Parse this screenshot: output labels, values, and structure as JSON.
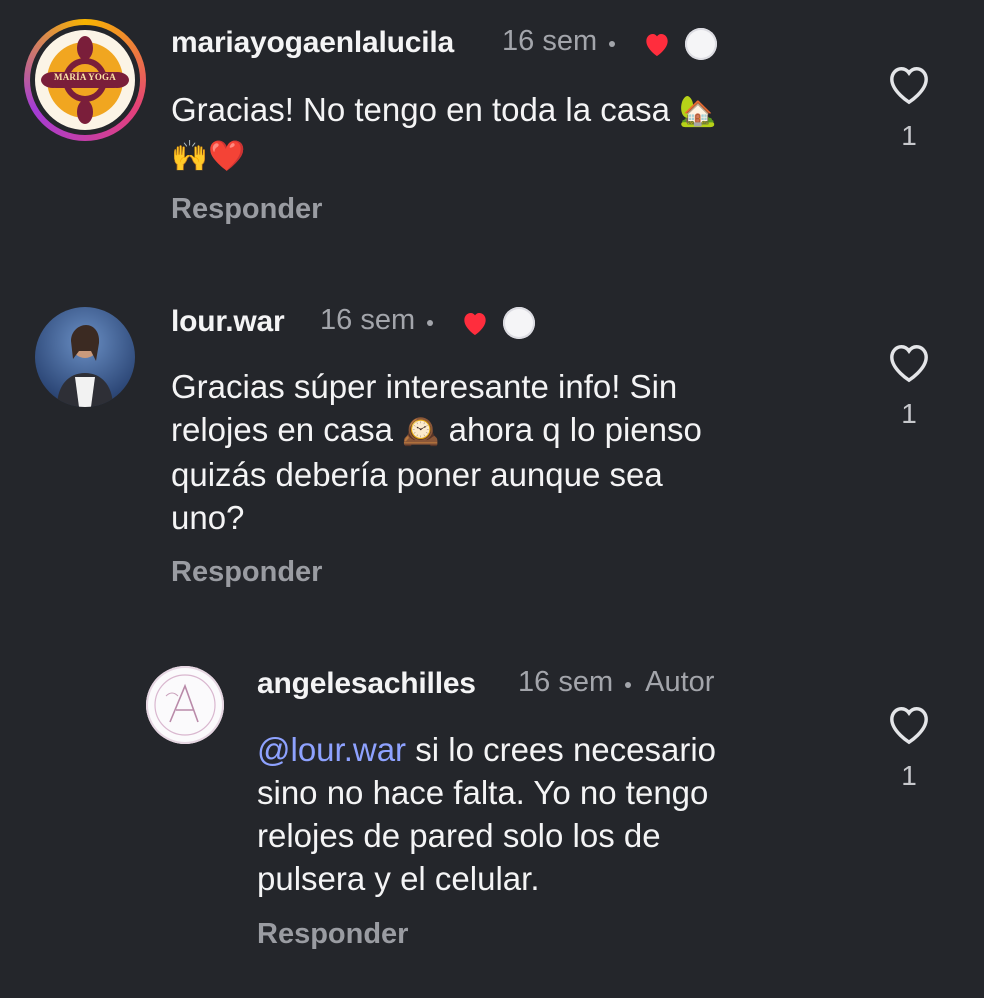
{
  "comments": [
    {
      "username": "mariayogaenlalucila",
      "time": "16 sem",
      "avatar_text": "MARÍA YOGA",
      "text_parts": [
        "Gracias! No tengo en toda la casa ",
        "🏡",
        "",
        "🙌❤️"
      ],
      "reply_label": "Responder",
      "like_count": "1",
      "liked_by_creator_icon": "heart-icon"
    },
    {
      "username": "lour.war",
      "time": "16 sem",
      "text_lines": [
        "Gracias súper interesante info! Sin",
        "relojes en casa ",
        "🕰️",
        " ahora q lo pienso",
        "quizás debería poner aunque sea",
        "uno?"
      ],
      "reply_label": "Responder",
      "like_count": "1",
      "liked_by_creator_icon": "heart-icon"
    },
    {
      "username": "angelesachilles",
      "time": "16 sem",
      "author_badge": "Autor",
      "mention": "@lour.war",
      "text_lines": [
        " si lo crees necesario",
        "sino no hace falta. Yo no tengo",
        "relojes de pared solo los de",
        "pulsera y el celular."
      ],
      "reply_label": "Responder",
      "like_count": "1"
    }
  ],
  "colors": {
    "background": "#24262b",
    "mention": "#8ea2ff",
    "heart_red": "#ff2d3d"
  }
}
